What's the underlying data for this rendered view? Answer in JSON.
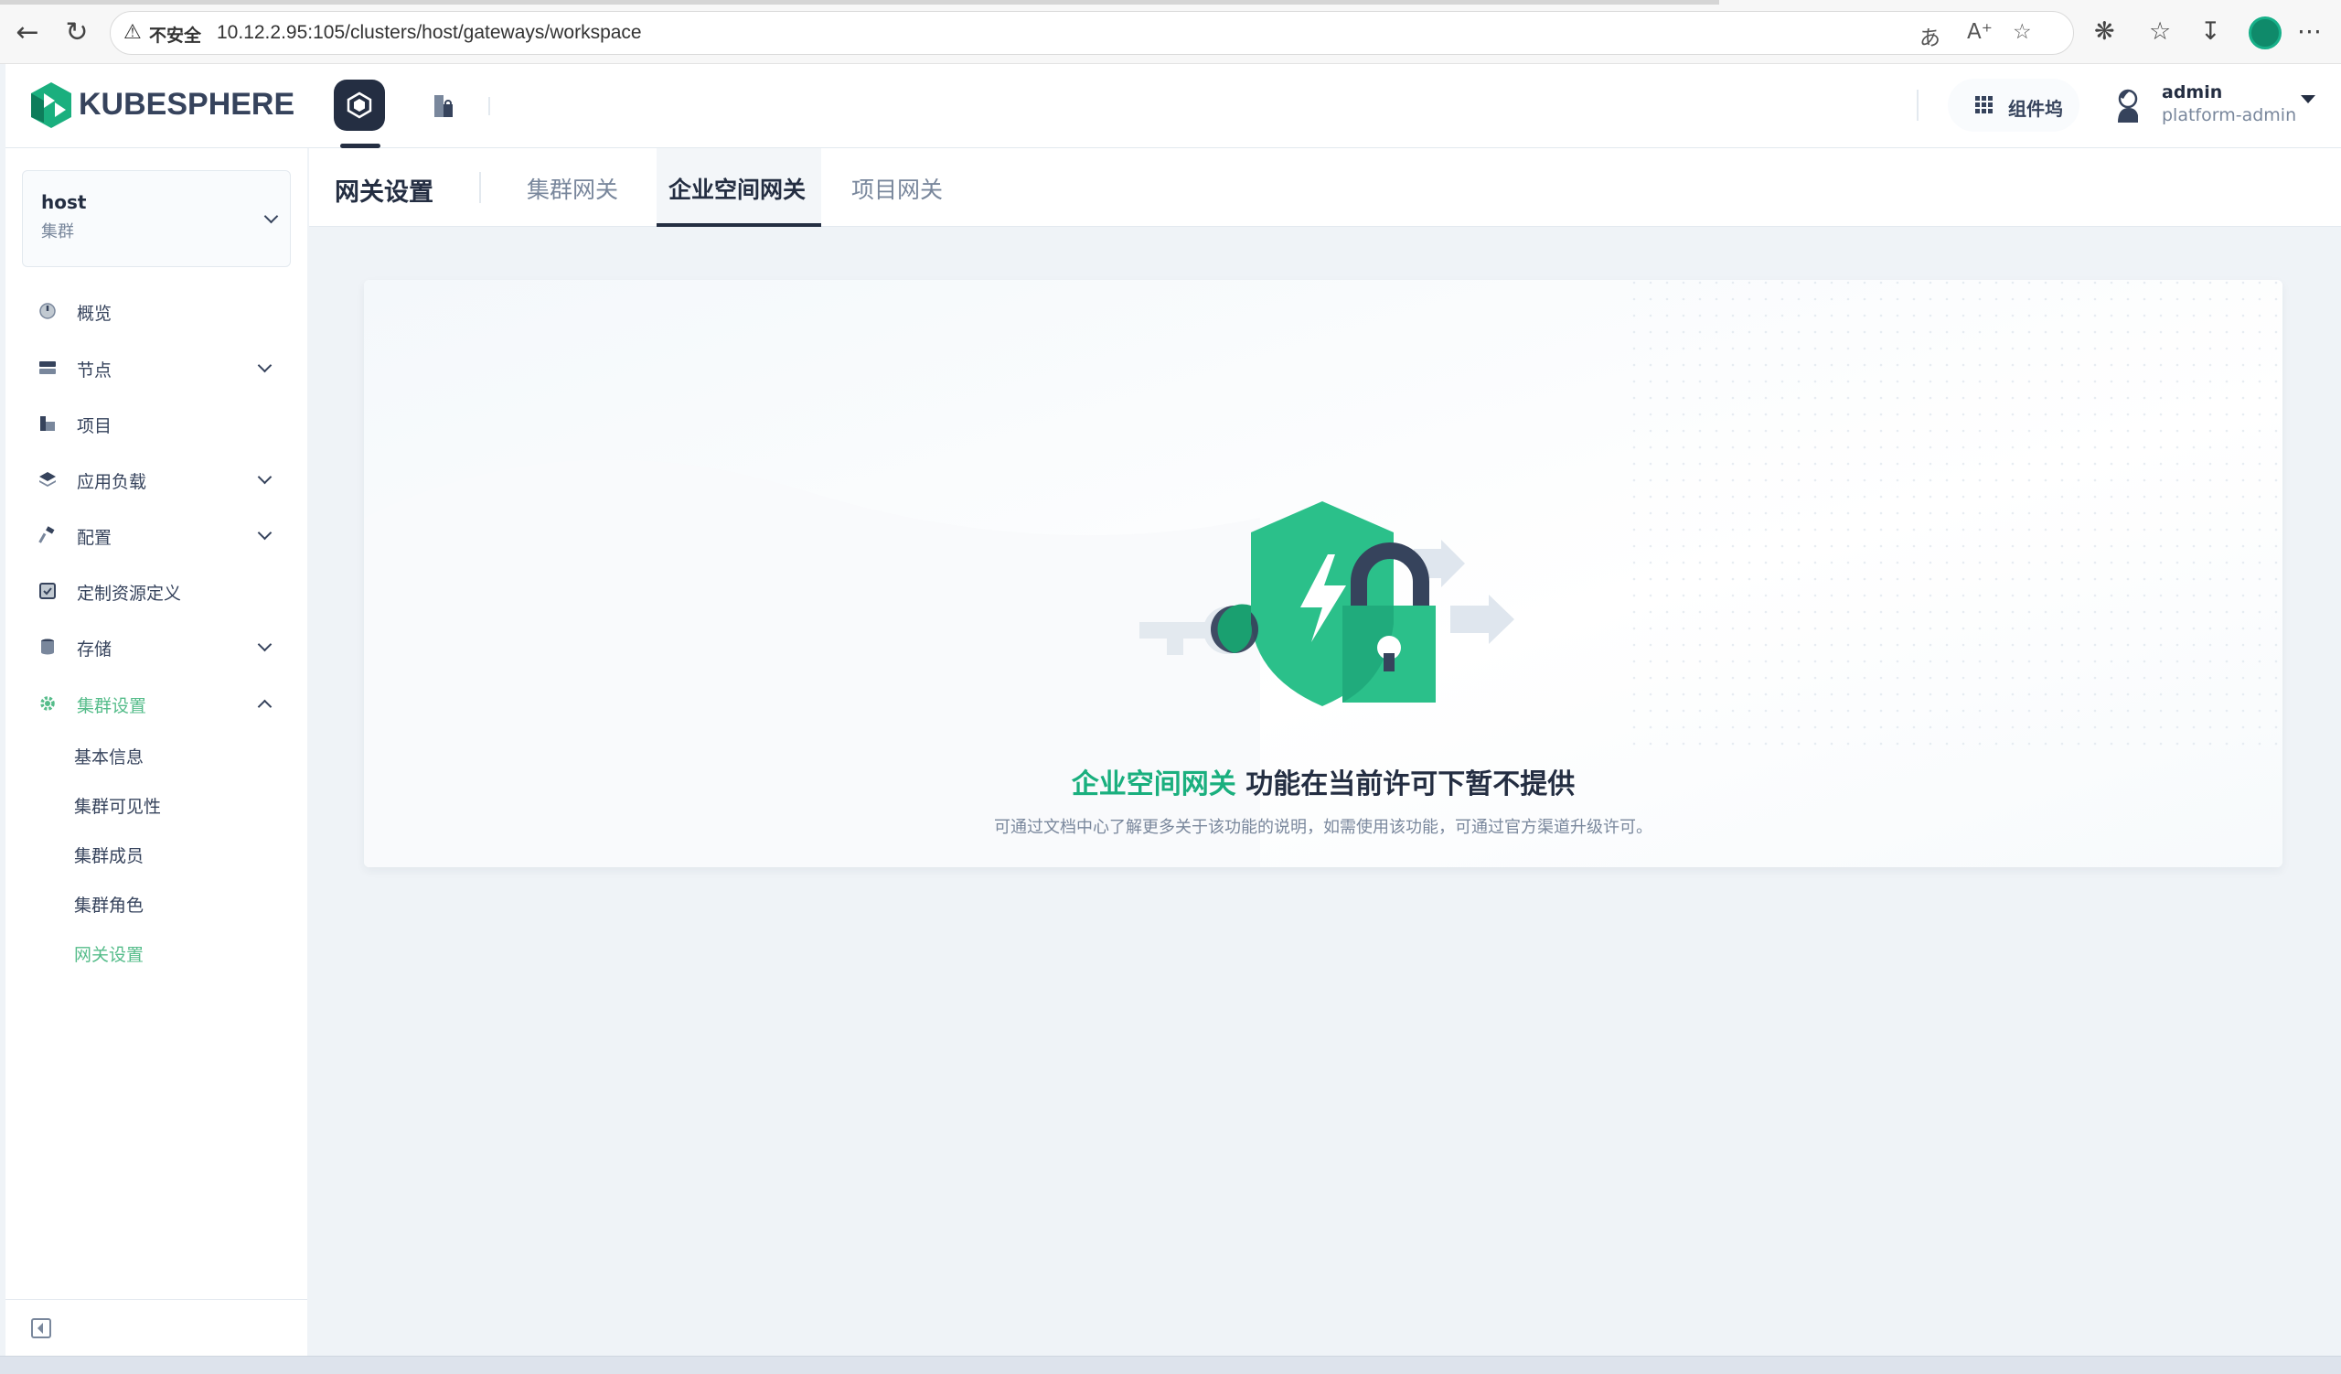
{
  "browser": {
    "security_label": "不安全",
    "url": "10.12.2.95:105/clusters/host/gateways/workspace"
  },
  "header": {
    "logo_text": "KUBESPHERE",
    "extensions_label": "组件坞",
    "user_name": "admin",
    "user_role": "platform-admin"
  },
  "sidebar": {
    "cluster_name": "host",
    "cluster_type": "集群",
    "items": [
      {
        "label": "概览"
      },
      {
        "label": "节点"
      },
      {
        "label": "项目"
      },
      {
        "label": "应用负载"
      },
      {
        "label": "配置"
      },
      {
        "label": "定制资源定义"
      },
      {
        "label": "存储"
      },
      {
        "label": "集群设置"
      }
    ],
    "sub_items": [
      {
        "label": "基本信息"
      },
      {
        "label": "集群可见性"
      },
      {
        "label": "集群成员"
      },
      {
        "label": "集群角色"
      },
      {
        "label": "网关设置"
      }
    ]
  },
  "tabs": {
    "title": "网关设置",
    "items": [
      {
        "label": "集群网关"
      },
      {
        "label": "企业空间网关"
      },
      {
        "label": "项目网关"
      }
    ]
  },
  "main": {
    "feature_name": "企业空间网关",
    "message": " 功能在当前许可下暂不提供",
    "sub_message": "可通过文档中心了解更多关于该功能的说明，如需使用该功能，可通过官方渠道升级许可。"
  },
  "colors": {
    "accent": "#55bc8a",
    "highlight": "#1aaf7e",
    "dark": "#242e42"
  }
}
